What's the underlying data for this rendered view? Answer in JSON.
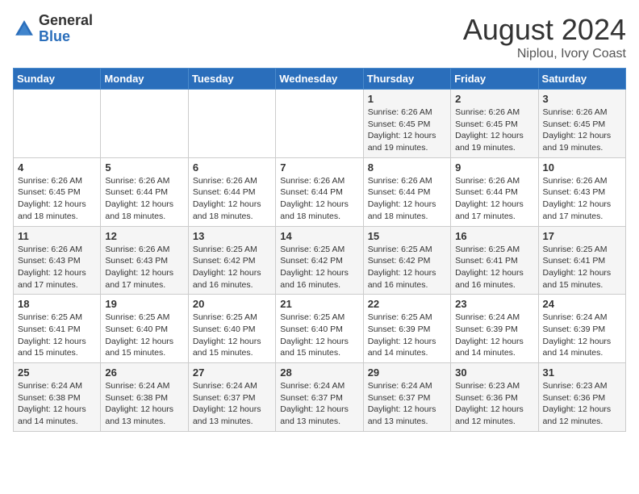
{
  "header": {
    "logo_general": "General",
    "logo_blue": "Blue",
    "month_year": "August 2024",
    "location": "Niplou, Ivory Coast"
  },
  "days_of_week": [
    "Sunday",
    "Monday",
    "Tuesday",
    "Wednesday",
    "Thursday",
    "Friday",
    "Saturday"
  ],
  "weeks": [
    [
      {
        "day": "",
        "info": ""
      },
      {
        "day": "",
        "info": ""
      },
      {
        "day": "",
        "info": ""
      },
      {
        "day": "",
        "info": ""
      },
      {
        "day": "1",
        "info": "Sunrise: 6:26 AM\nSunset: 6:45 PM\nDaylight: 12 hours\nand 19 minutes."
      },
      {
        "day": "2",
        "info": "Sunrise: 6:26 AM\nSunset: 6:45 PM\nDaylight: 12 hours\nand 19 minutes."
      },
      {
        "day": "3",
        "info": "Sunrise: 6:26 AM\nSunset: 6:45 PM\nDaylight: 12 hours\nand 19 minutes."
      }
    ],
    [
      {
        "day": "4",
        "info": "Sunrise: 6:26 AM\nSunset: 6:45 PM\nDaylight: 12 hours\nand 18 minutes."
      },
      {
        "day": "5",
        "info": "Sunrise: 6:26 AM\nSunset: 6:44 PM\nDaylight: 12 hours\nand 18 minutes."
      },
      {
        "day": "6",
        "info": "Sunrise: 6:26 AM\nSunset: 6:44 PM\nDaylight: 12 hours\nand 18 minutes."
      },
      {
        "day": "7",
        "info": "Sunrise: 6:26 AM\nSunset: 6:44 PM\nDaylight: 12 hours\nand 18 minutes."
      },
      {
        "day": "8",
        "info": "Sunrise: 6:26 AM\nSunset: 6:44 PM\nDaylight: 12 hours\nand 18 minutes."
      },
      {
        "day": "9",
        "info": "Sunrise: 6:26 AM\nSunset: 6:44 PM\nDaylight: 12 hours\nand 17 minutes."
      },
      {
        "day": "10",
        "info": "Sunrise: 6:26 AM\nSunset: 6:43 PM\nDaylight: 12 hours\nand 17 minutes."
      }
    ],
    [
      {
        "day": "11",
        "info": "Sunrise: 6:26 AM\nSunset: 6:43 PM\nDaylight: 12 hours\nand 17 minutes."
      },
      {
        "day": "12",
        "info": "Sunrise: 6:26 AM\nSunset: 6:43 PM\nDaylight: 12 hours\nand 17 minutes."
      },
      {
        "day": "13",
        "info": "Sunrise: 6:25 AM\nSunset: 6:42 PM\nDaylight: 12 hours\nand 16 minutes."
      },
      {
        "day": "14",
        "info": "Sunrise: 6:25 AM\nSunset: 6:42 PM\nDaylight: 12 hours\nand 16 minutes."
      },
      {
        "day": "15",
        "info": "Sunrise: 6:25 AM\nSunset: 6:42 PM\nDaylight: 12 hours\nand 16 minutes."
      },
      {
        "day": "16",
        "info": "Sunrise: 6:25 AM\nSunset: 6:41 PM\nDaylight: 12 hours\nand 16 minutes."
      },
      {
        "day": "17",
        "info": "Sunrise: 6:25 AM\nSunset: 6:41 PM\nDaylight: 12 hours\nand 15 minutes."
      }
    ],
    [
      {
        "day": "18",
        "info": "Sunrise: 6:25 AM\nSunset: 6:41 PM\nDaylight: 12 hours\nand 15 minutes."
      },
      {
        "day": "19",
        "info": "Sunrise: 6:25 AM\nSunset: 6:40 PM\nDaylight: 12 hours\nand 15 minutes."
      },
      {
        "day": "20",
        "info": "Sunrise: 6:25 AM\nSunset: 6:40 PM\nDaylight: 12 hours\nand 15 minutes."
      },
      {
        "day": "21",
        "info": "Sunrise: 6:25 AM\nSunset: 6:40 PM\nDaylight: 12 hours\nand 15 minutes."
      },
      {
        "day": "22",
        "info": "Sunrise: 6:25 AM\nSunset: 6:39 PM\nDaylight: 12 hours\nand 14 minutes."
      },
      {
        "day": "23",
        "info": "Sunrise: 6:24 AM\nSunset: 6:39 PM\nDaylight: 12 hours\nand 14 minutes."
      },
      {
        "day": "24",
        "info": "Sunrise: 6:24 AM\nSunset: 6:39 PM\nDaylight: 12 hours\nand 14 minutes."
      }
    ],
    [
      {
        "day": "25",
        "info": "Sunrise: 6:24 AM\nSunset: 6:38 PM\nDaylight: 12 hours\nand 14 minutes."
      },
      {
        "day": "26",
        "info": "Sunrise: 6:24 AM\nSunset: 6:38 PM\nDaylight: 12 hours\nand 13 minutes."
      },
      {
        "day": "27",
        "info": "Sunrise: 6:24 AM\nSunset: 6:37 PM\nDaylight: 12 hours\nand 13 minutes."
      },
      {
        "day": "28",
        "info": "Sunrise: 6:24 AM\nSunset: 6:37 PM\nDaylight: 12 hours\nand 13 minutes."
      },
      {
        "day": "29",
        "info": "Sunrise: 6:24 AM\nSunset: 6:37 PM\nDaylight: 12 hours\nand 13 minutes."
      },
      {
        "day": "30",
        "info": "Sunrise: 6:23 AM\nSunset: 6:36 PM\nDaylight: 12 hours\nand 12 minutes."
      },
      {
        "day": "31",
        "info": "Sunrise: 6:23 AM\nSunset: 6:36 PM\nDaylight: 12 hours\nand 12 minutes."
      }
    ]
  ]
}
